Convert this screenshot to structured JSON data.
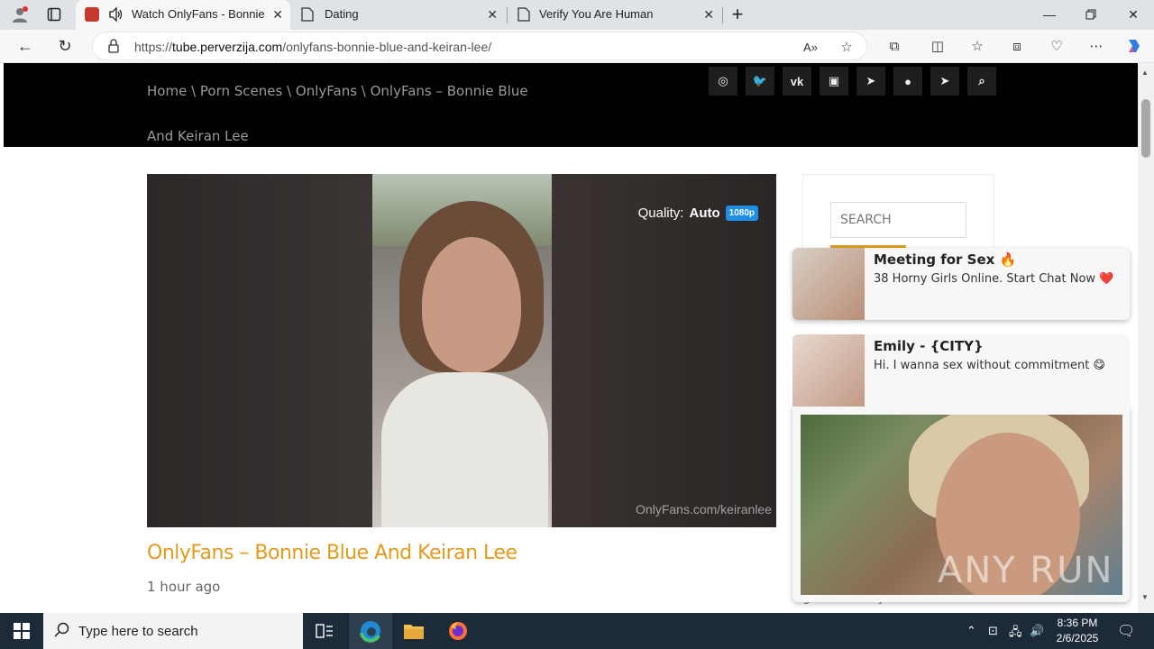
{
  "browser": {
    "tabs": [
      {
        "title": "Watch OnlyFans - Bonnie Bl",
        "active": true
      },
      {
        "title": "Dating",
        "active": false
      },
      {
        "title": "Verify You Are Human",
        "active": false
      }
    ],
    "url": {
      "prefix": "https://",
      "domain": "tube.perverzija.com",
      "path": "/onlyfans-bonnie-blue-and-keiran-lee/"
    }
  },
  "site": {
    "breadcrumb": "Home \\ Porn Scenes \\ OnlyFans \\ OnlyFans – Bonnie Blue And Keiran Lee",
    "social_icons": [
      "instagram-icon",
      "twitter-icon",
      "vk-icon",
      "discord-icon",
      "telegram-icon",
      "reddit-icon",
      "telegram-alt-icon",
      "search-icon"
    ]
  },
  "video": {
    "quality_label": "Quality:",
    "quality_value": "Auto",
    "quality_badge": "1080p",
    "watermark": "OnlyFans.com/keiranlee"
  },
  "post": {
    "title": "OnlyFans – Bonnie Blue And Keiran Lee",
    "posted": "1 hour ago"
  },
  "sidebar": {
    "search_placeholder": "SEARCH",
    "partial_text": "get back to you when we do."
  },
  "notifications": [
    {
      "title": "Meeting for Sex 🔥",
      "body": "38 Horny Girls Online. Start Chat Now ❤️"
    },
    {
      "title": "Emily - {CITY}",
      "body": "Hi. I wanna sex without commitment 😋"
    }
  ],
  "overlay_watermark": "ANY RUN",
  "taskbar": {
    "search_placeholder": "Type here to search",
    "time": "8:36 PM",
    "date": "2/6/2025"
  }
}
